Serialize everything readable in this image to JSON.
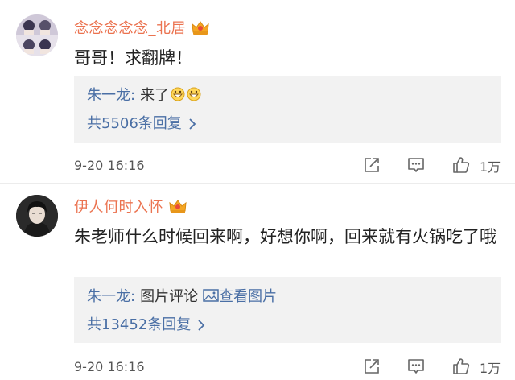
{
  "comments": [
    {
      "username": "念念念念念_北居",
      "text": "哥哥！求翻牌！",
      "reply_preview": {
        "user": "朱一龙:",
        "text": "来了"
      },
      "reply_count_text": "共5506条回复",
      "time": "9-20 16:16",
      "like_count": "1万"
    },
    {
      "username": "伊人何时入怀",
      "text": "朱老师什么时候回来啊，好想你啊，回来就有火锅吃了哦",
      "reply_preview": {
        "user": "朱一龙:",
        "text": "图片评论",
        "link": "查看图片"
      },
      "reply_count_text": "共13452条回复",
      "time": "9-20 16:16",
      "like_count": "1万"
    }
  ],
  "colors": {
    "username": "#eb7350",
    "link": "#4a6fa5",
    "reply_bg": "#f2f2f2",
    "crown": "#f5a623"
  },
  "icons": [
    "crown-icon",
    "grin-emoji-icon",
    "image-icon",
    "chevron-right-icon",
    "share-icon",
    "comment-icon",
    "like-icon"
  ]
}
